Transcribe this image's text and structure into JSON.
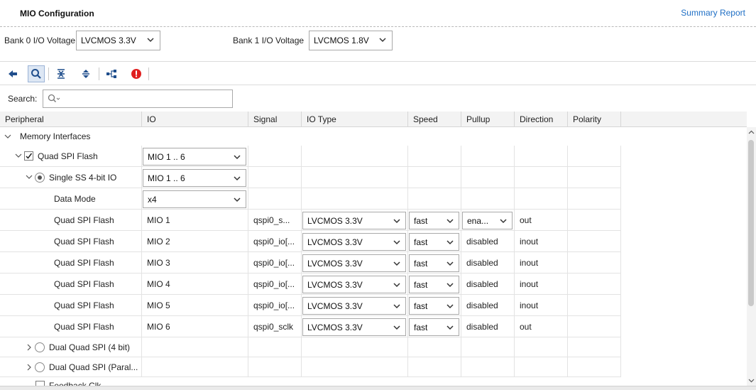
{
  "header": {
    "title": "MIO Configuration",
    "summary_link": "Summary Report"
  },
  "voltage": {
    "bank0_label": "Bank 0 I/O Voltage",
    "bank0_value": "LVCMOS 3.3V",
    "bank1_label": "Bank 1 I/O Voltage",
    "bank1_value": "LVCMOS 1.8V"
  },
  "toolbar": {
    "icons": [
      "back-arrow-icon",
      "search-icon",
      "collapse-all-icon",
      "expand-all-icon",
      "hierarchy-icon",
      "error-icon"
    ],
    "error_color": "#e02020",
    "accent_color": "#1f4e8c"
  },
  "search": {
    "label": "Search:",
    "value": ""
  },
  "columns": {
    "peripheral": "Peripheral",
    "io": "IO",
    "signal": "Signal",
    "io_type": "IO Type",
    "speed": "Speed",
    "pullup": "Pullup",
    "direction": "Direction",
    "polarity": "Polarity"
  },
  "tree": {
    "memory_interfaces": "Memory Interfaces",
    "quad_spi_flash": {
      "label": "Quad SPI Flash",
      "io": "MIO 1 .. 6",
      "checked": true
    },
    "single_ss": {
      "label": "Single SS 4-bit IO",
      "io": "MIO 1 .. 6",
      "selected": true
    },
    "data_mode": {
      "label": "Data Mode",
      "value": "x4"
    },
    "dual_quad_4bit": "Dual Quad SPI (4 bit)",
    "dual_quad_parallel": "Dual Quad SPI (Paral...",
    "feedback_clk": "Feedback Clk"
  },
  "pins": [
    {
      "peripheral": "Quad SPI Flash",
      "io": "MIO 1",
      "signal": "qspi0_s...",
      "io_type": "LVCMOS 3.3V",
      "speed": "fast",
      "pullup": "ena...",
      "pullup_combo": true,
      "direction": "out"
    },
    {
      "peripheral": "Quad SPI Flash",
      "io": "MIO 2",
      "signal": "qspi0_io[...",
      "io_type": "LVCMOS 3.3V",
      "speed": "fast",
      "pullup": "disabled",
      "pullup_combo": false,
      "direction": "inout"
    },
    {
      "peripheral": "Quad SPI Flash",
      "io": "MIO 3",
      "signal": "qspi0_io[...",
      "io_type": "LVCMOS 3.3V",
      "speed": "fast",
      "pullup": "disabled",
      "pullup_combo": false,
      "direction": "inout"
    },
    {
      "peripheral": "Quad SPI Flash",
      "io": "MIO 4",
      "signal": "qspi0_io[...",
      "io_type": "LVCMOS 3.3V",
      "speed": "fast",
      "pullup": "disabled",
      "pullup_combo": false,
      "direction": "inout"
    },
    {
      "peripheral": "Quad SPI Flash",
      "io": "MIO 5",
      "signal": "qspi0_io[...",
      "io_type": "LVCMOS 3.3V",
      "speed": "fast",
      "pullup": "disabled",
      "pullup_combo": false,
      "direction": "inout"
    },
    {
      "peripheral": "Quad SPI Flash",
      "io": "MIO 6",
      "signal": "qspi0_sclk",
      "io_type": "LVCMOS 3.3V",
      "speed": "fast",
      "pullup": "disabled",
      "pullup_combo": false,
      "direction": "out"
    }
  ]
}
